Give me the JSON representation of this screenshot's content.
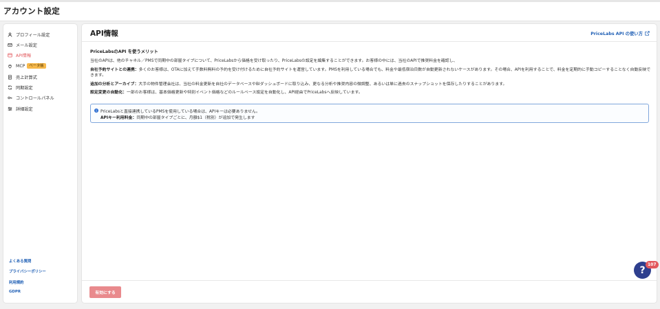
{
  "page": {
    "title": "アカウント設定"
  },
  "sidebar": {
    "items": [
      {
        "label": "プロフィール設定",
        "icon": "user-icon"
      },
      {
        "label": "メール設定",
        "icon": "mail-icon"
      },
      {
        "label": "API情報",
        "icon": "api-icon",
        "active": true
      },
      {
        "label": "MCP",
        "icon": "plug-icon",
        "badge": "ベータ版"
      },
      {
        "label": "売上計算式",
        "icon": "document-icon"
      },
      {
        "label": "同期設定",
        "icon": "sync-icon"
      },
      {
        "label": "コントロールパネル",
        "icon": "key-icon"
      },
      {
        "label": "詳細設定",
        "icon": "sliders-icon"
      }
    ],
    "footer_links": [
      "よくある質問",
      "プライバシーポリシー",
      "利用規約",
      "GDPR"
    ]
  },
  "main": {
    "title": "API情報",
    "help_link": "PriceLabs API の使い方",
    "benefit_heading": "PriceLabsのAPI を使うメリット",
    "intro": "当社のAPIは、他のチャネル／PMSで同期中の部屋タイプについて、PriceLabsから価格を受け取ったり、PriceLabsの設定を編集することができます。お客様の中には、当社のAPIで推奨料金を確認し、",
    "paragraphs": [
      {
        "bold": "自社予約サイトとの連携：",
        "text": "多くのお客様は、OTAに加えて手数料無料の予約を受け付けるために自社予約サイトを運営しています。PMSを利用している場合でも、料金や最低宿泊日数が自動更新されないケースがあります。その場合、APIを利用することで、料金を定期的に手動コピーすることなく自動反映できます。"
      },
      {
        "bold": "追加の分析とアーカイブ：",
        "text": "大手の物件管理会社は、当社の料金更新を自社のデータベースやBIダッシュボードに取り込み、更なる分析や推奨内容の微調整、あるいは単に過去のスナップショットを保存したりすることがあります。"
      },
      {
        "bold": "設定変更の自動化：",
        "text": "一部のお客様は、基本価格更新や特別イベント価格などのルールベース設定を自動化し、API経由でPriceLabsへ反映しています。"
      }
    ],
    "info_box": {
      "line1": "PriceLabsと直接連携しているPMSを使用している場合は、APIキーは必要ありません。",
      "line2_bold": "APIキー利用料金：",
      "line2_text": "同期中の部屋タイプごとに、月額$1（税別）が追加で発生します"
    },
    "enable_button": "有効にする"
  },
  "help_widget": {
    "symbol": "?",
    "count": "107"
  },
  "colors": {
    "accent": "#e2585c",
    "link": "#1f5fb5",
    "badge": "#f6b84a",
    "help": "#2e3f8e"
  }
}
